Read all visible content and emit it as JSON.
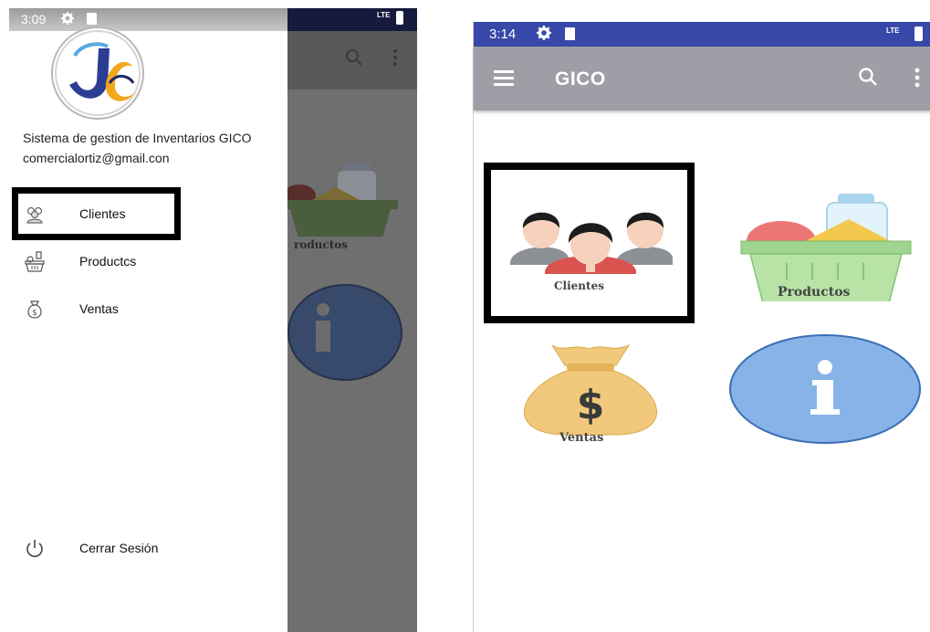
{
  "left_screen": {
    "status_bar": {
      "time": "3:09",
      "network": "LTE"
    },
    "drawer": {
      "header": {
        "title": "Sistema de gestion de Inventarios GICO",
        "email": "comercialortiz@gmail.con"
      },
      "items": [
        {
          "label": "Clientes",
          "icon": "clients-icon"
        },
        {
          "label": "Productcs",
          "icon": "basket-icon"
        },
        {
          "label": "Ventas",
          "icon": "money-bag-icon"
        }
      ],
      "footer_item": {
        "label": "Cerrar Sesión",
        "icon": "power-icon"
      }
    },
    "background_tile_label": "roductos"
  },
  "right_screen": {
    "status_bar": {
      "time": "3:14",
      "network": "LTE"
    },
    "appbar": {
      "title": "GICO"
    },
    "tiles": [
      {
        "label": "Clientes",
        "icon": "clients-icon"
      },
      {
        "label": "Productos",
        "icon": "basket-icon"
      },
      {
        "label": "Ventas",
        "icon": "money-bag-icon"
      },
      {
        "label": "",
        "icon": "info-icon"
      }
    ]
  },
  "colors": {
    "status_bar_blue": "#3848a8",
    "appbar_gray": "#9e9fa6",
    "highlight_border": "#000000",
    "basket_green": "#9fd58f",
    "info_blue": "#88b3e8",
    "money_bag": "#f2c97c"
  }
}
